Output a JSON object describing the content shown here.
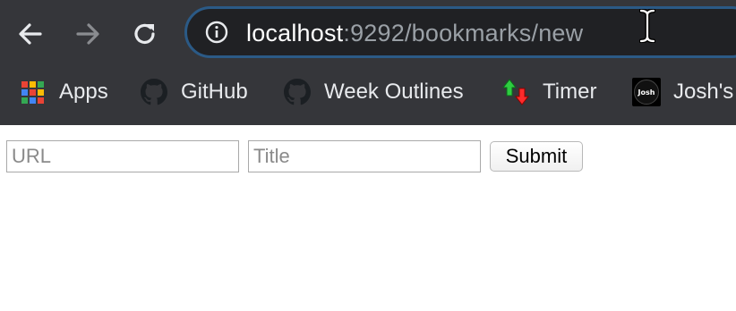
{
  "browser": {
    "url_host": "localhost",
    "url_rest": ":9292/bookmarks/new",
    "back_icon": "back-arrow-icon",
    "forward_icon": "forward-arrow-icon",
    "reload_icon": "reload-icon",
    "info_icon": "info-icon"
  },
  "bookmarks_bar": {
    "items": [
      {
        "label": "Apps",
        "icon": "apps-grid-icon"
      },
      {
        "label": "GitHub",
        "icon": "github-icon"
      },
      {
        "label": "Week Outlines",
        "icon": "github-icon"
      },
      {
        "label": "Timer",
        "icon": "timer-arrows-icon"
      },
      {
        "label": "Josh's",
        "icon": "josh-logo-icon",
        "icon_text": "Josh"
      }
    ]
  },
  "form": {
    "url_placeholder": "URL",
    "title_placeholder": "Title",
    "submit_label": "Submit"
  },
  "colors": {
    "chrome_bg": "#35363a",
    "omnibox_bg": "#202124",
    "omnibox_border": "#2b5a86",
    "url_host": "#ffffff",
    "url_path": "#9aa0a6"
  }
}
